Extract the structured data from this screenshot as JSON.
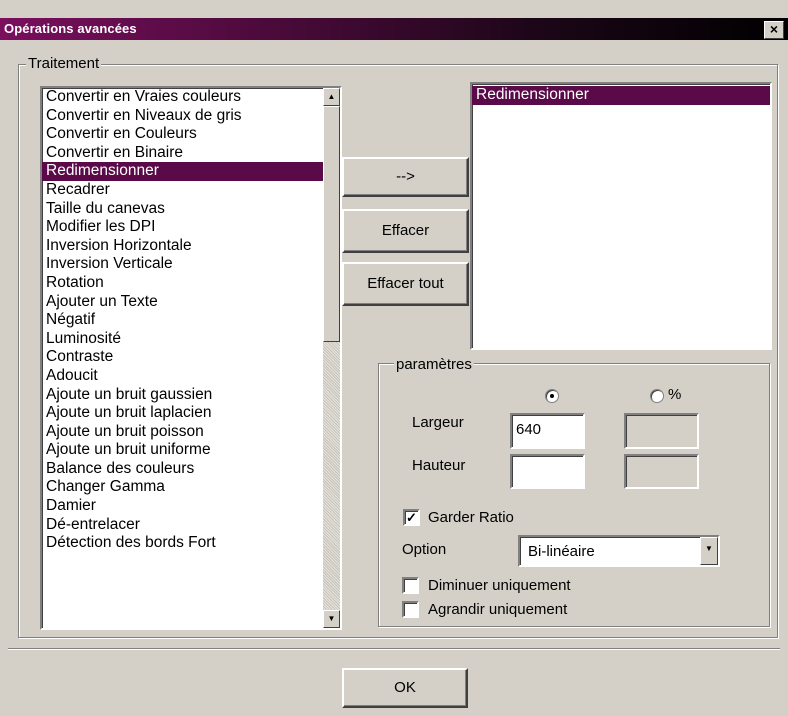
{
  "window": {
    "title": "Opérations avancées",
    "close_symbol": "×"
  },
  "traitement": {
    "legend": "Traitement",
    "operations": [
      "Convertir en Vraies couleurs",
      "Convertir en Niveaux de gris",
      "Convertir en Couleurs",
      "Convertir en Binaire",
      "Redimensionner",
      "Recadrer",
      "Taille du canevas",
      "Modifier les DPI",
      "Inversion Horizontale",
      "Inversion Verticale",
      "Rotation",
      "Ajouter un Texte",
      "Négatif",
      "Luminosité",
      "Contraste",
      "Adoucit",
      "Ajoute un bruit gaussien",
      "Ajoute un bruit laplacien",
      "Ajoute un bruit poisson",
      "Ajoute un bruit uniforme",
      "Balance des couleurs",
      "Changer Gamma",
      "Damier",
      "Dé-entrelacer",
      "Détection des bords Fort"
    ],
    "selected_operation": "Redimensionner",
    "selected_list": [
      "Redimensionner"
    ],
    "buttons": {
      "add": "-->",
      "clear": "Effacer",
      "clear_all": "Effacer tout"
    }
  },
  "parametres": {
    "legend": "paramètres",
    "unit_percent_label": "%",
    "radio_pixels_selected": true,
    "width_label": "Largeur",
    "width_value": "640",
    "height_label": "Hauteur",
    "height_value": "",
    "keep_ratio_label": "Garder Ratio",
    "keep_ratio_checked": true,
    "option_label": "Option",
    "option_value": "Bi-linéaire",
    "shrink_only_label": "Diminuer uniquement",
    "enlarge_only_label": "Agrandir uniquement"
  },
  "footer": {
    "ok_label": "OK"
  },
  "colors": {
    "selection": "#5a0a48",
    "title_start": "#7a0f5e",
    "face": "#d4d0c8"
  }
}
